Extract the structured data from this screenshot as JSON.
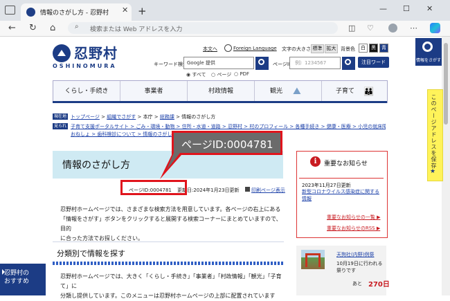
{
  "browser": {
    "tab_title": "情報のさがし方 - 忍野村",
    "address_placeholder": "検索または Web アドレスを入力"
  },
  "header": {
    "logo_text": "忍野村",
    "logo_sub": "OSHINOMURA",
    "links": {
      "honbun": "本文へ",
      "foreign": "Foreign Language"
    },
    "font_size_label": "文字の大きさ",
    "font_standard": "標準",
    "font_large": "拡大",
    "bg_color_label": "背景色",
    "bg_white": "白",
    "bg_black": "黒",
    "bg_blue": "青",
    "keyword_label": "キーワード検索",
    "keyword_google": "Google 提供",
    "radio_all": "すべて",
    "radio_page": "ページ",
    "radio_pdf": "PDF",
    "pageid_label": "ページID検索",
    "pageid_placeholder": "例）1234567",
    "featured_button": "注目ワード",
    "search_side_label": "情報をさがす"
  },
  "nav": [
    "くらし・手続き",
    "事業者",
    "村政情報",
    "観光",
    "子育て"
  ],
  "breadcrumb": {
    "current_tag": "現在地",
    "items": [
      "トップページ",
      "組織でさがす",
      "本庁",
      "総務課",
      "情報のさがし方"
    ],
    "seps": [
      ">",
      ">",
      ">",
      ">"
    ],
    "related_tag": "見られている",
    "related_line1": "子育て支援ポータルサイト > ごみ・環境・動物 > 住所・水道・道路 > 忍野村 > 村のプロフィール > 各種手続き > 健康・医療 > 小児の就床障害 ちびりと",
    "related_line2": "おねしょ > 歯科検診について > 情報のさがし方"
  },
  "title": "情報のさがし方",
  "meta": {
    "page_id": "ページID:0004781",
    "updated": "更新日:2024年1月23日更新",
    "print": "印刷ページ表示"
  },
  "callout": "ページID:0004781",
  "intro": [
    "忍野村ホームページでは、さまざまな検索方法を用意しています。各ページの右上にある",
    "「情報をさがす」ボタンをクリックすると展開する検索コーナーにまとめていますので、目的",
    "に合った方法でお探しください。"
  ],
  "section_title": "分類別で情報を探す",
  "section_text": [
    "忍野村ホームページでは、大きく「くらし・手続き」「事業者」「村政情報」「観光」「子育て」に",
    "分類し提供しています。このメニューは忍野村ホームページの上部に配置されています"
  ],
  "notice": {
    "icon": "i",
    "title": "重要なお知らせ",
    "date": "2023年11月27日更新",
    "item": "新型コロナウイルス感染症に関する情報",
    "more1": "重要なお知らせの一覧 ▶",
    "more2": "重要なお知らせのRSS ▶"
  },
  "event": {
    "name": "天狗社(内野)例祭",
    "desc": "10月19日に行われる祭りです",
    "ato": "あと",
    "days": "270日"
  },
  "save_tab": "このページアドレスを保存",
  "save_star": "★",
  "recommend": [
    "忍野村の",
    "おすすめ"
  ],
  "colors": {
    "brand": "#1c3c85",
    "accent_red": "#e0141c",
    "title_band": "#cfeaf3"
  }
}
